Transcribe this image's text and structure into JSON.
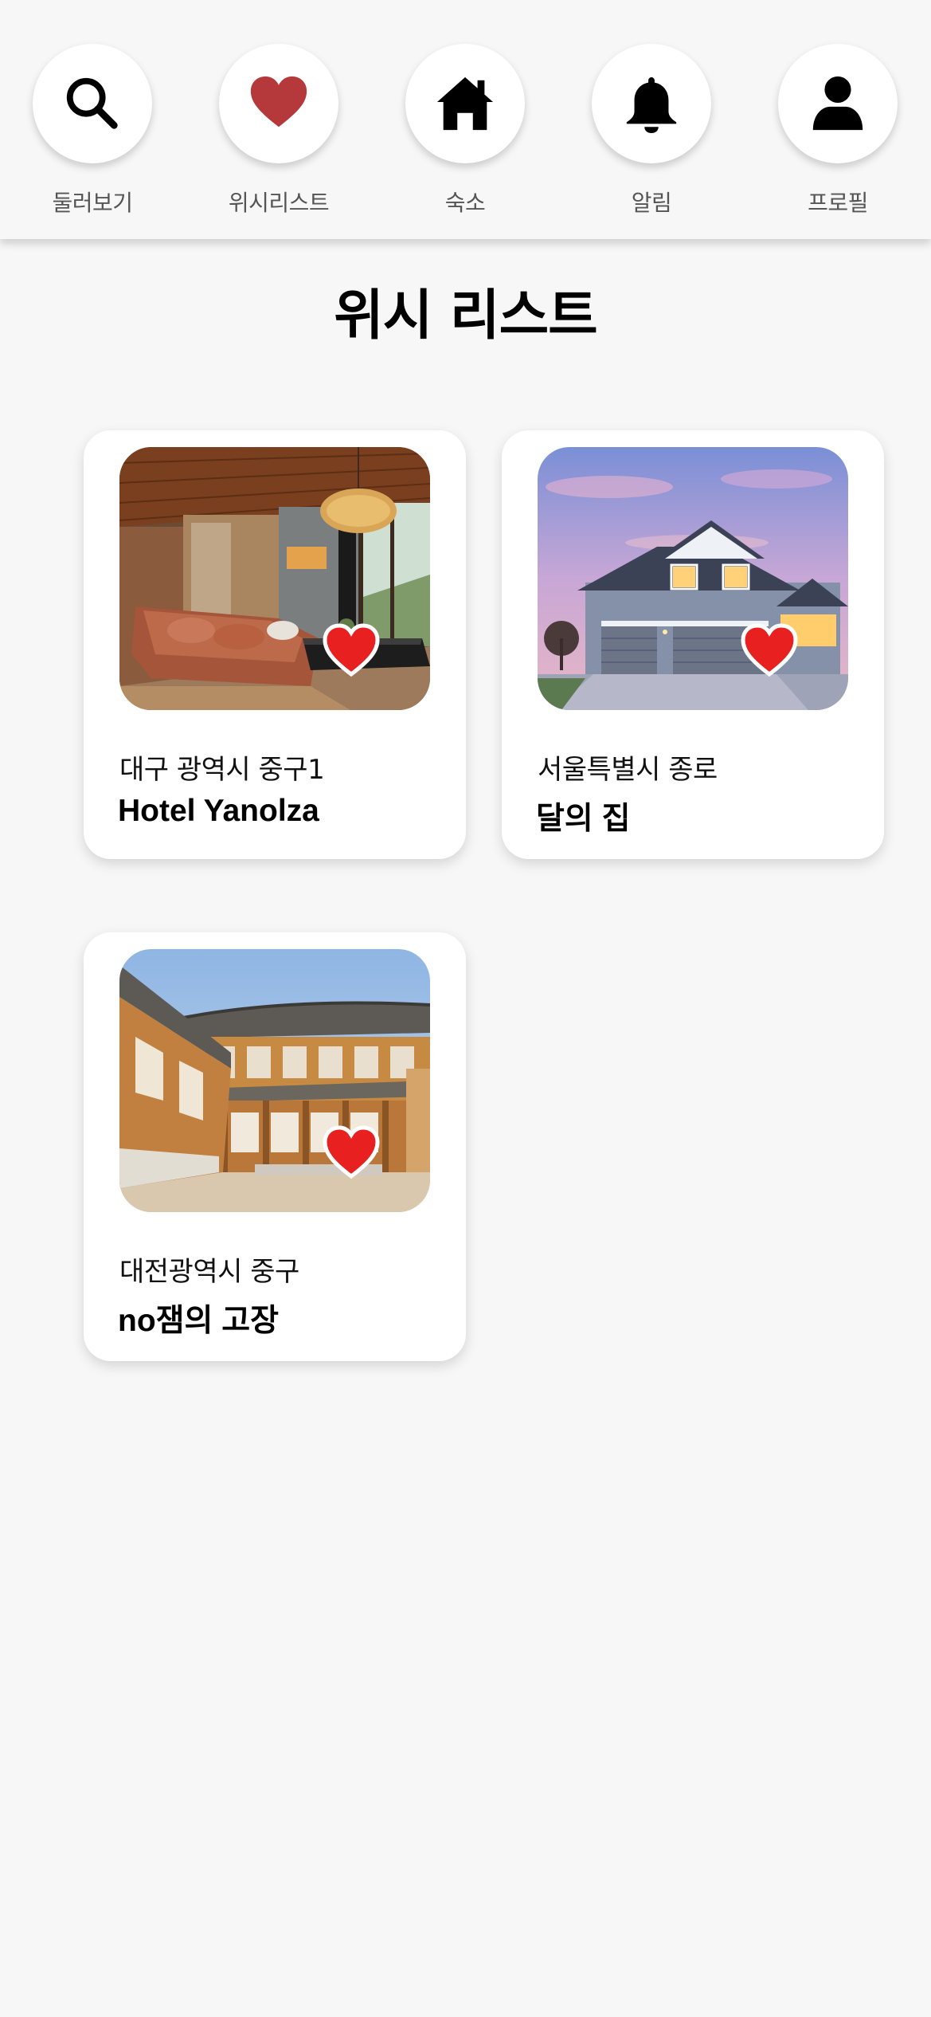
{
  "nav": {
    "items": [
      {
        "label": "둘러보기",
        "icon": "search-icon"
      },
      {
        "label": "위시리스트",
        "icon": "heart-icon",
        "active_color": "#b5383b"
      },
      {
        "label": "숙소",
        "icon": "home-icon"
      },
      {
        "label": "알림",
        "icon": "bell-icon"
      },
      {
        "label": "프로필",
        "icon": "user-icon"
      }
    ]
  },
  "page": {
    "title": "위시 리스트"
  },
  "wishlist": [
    {
      "address": "대구 광역시 중구1",
      "name": "Hotel Yanolza",
      "photo": "modern-living-room-photo",
      "favorited": true
    },
    {
      "address": "서울특별시 종로",
      "name": "달의 집",
      "photo": "suburban-house-photo",
      "favorited": true
    },
    {
      "address": "대전광역시 중구",
      "name": "no잼의 고장",
      "photo": "hanok-courtyard-photo",
      "favorited": true
    }
  ],
  "colors": {
    "heart_red": "#e8201f",
    "background": "#f7f7f7",
    "card": "#ffffff"
  }
}
